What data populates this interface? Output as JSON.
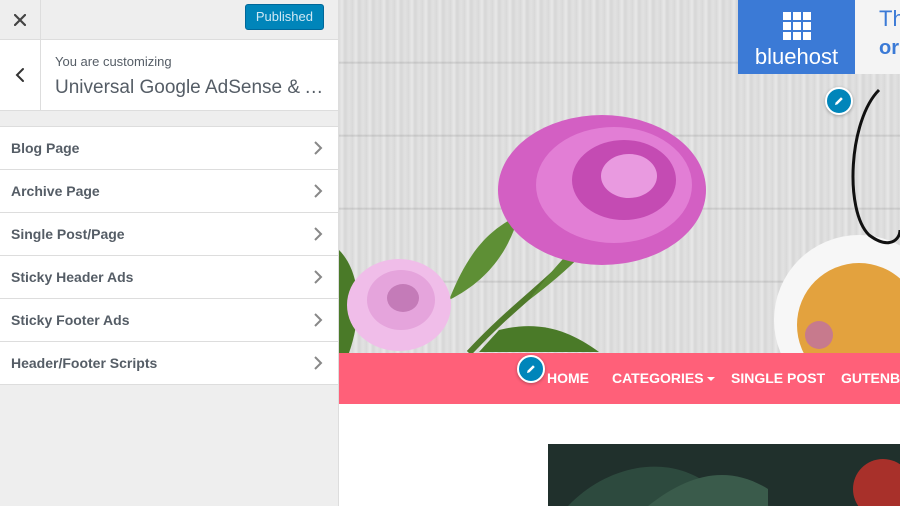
{
  "header": {
    "publish_label": "Published"
  },
  "info": {
    "label": "You are customizing",
    "title": "Universal Google AdSense & A..."
  },
  "menu": {
    "items": [
      {
        "label": "Blog Page"
      },
      {
        "label": "Archive Page"
      },
      {
        "label": "Single Post/Page"
      },
      {
        "label": "Sticky Header Ads"
      },
      {
        "label": "Sticky Footer Ads"
      },
      {
        "label": "Header/Footer Scripts"
      }
    ]
  },
  "preview": {
    "ad": {
      "brand": "bluehost",
      "side_line1": "Th",
      "side_line2": "or"
    },
    "nav": {
      "items": [
        "HOME",
        "CATEGORIES",
        "SINGLE POST",
        "GUTENBE"
      ]
    }
  },
  "colors": {
    "accent": "#0085ba",
    "nav_bg": "#ff6079",
    "ad_bg": "#3b7ad6"
  },
  "icons": [
    "close-icon",
    "back-arrow-icon",
    "chevron-right-icon",
    "pencil-icon",
    "caret-down-icon",
    "grid-logo-icon"
  ]
}
